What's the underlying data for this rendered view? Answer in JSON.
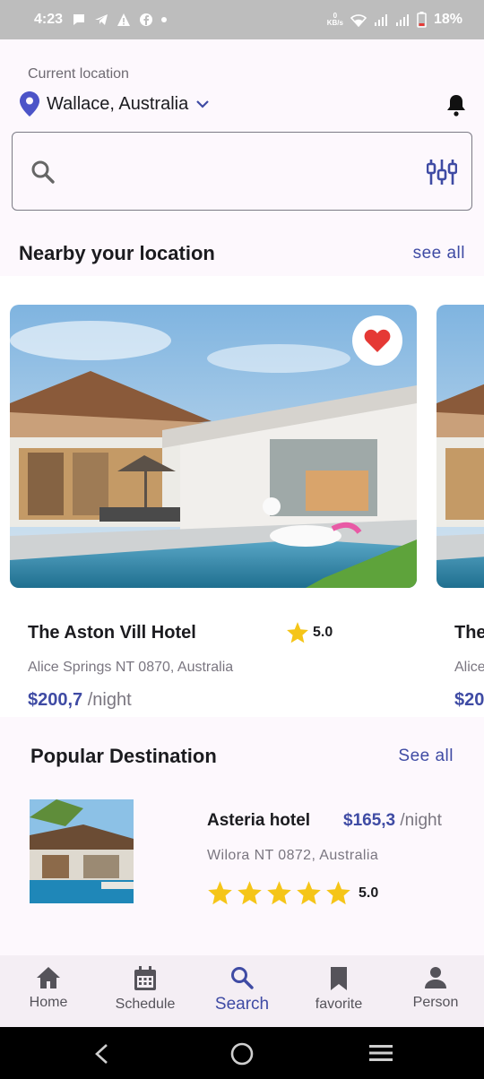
{
  "status_bar": {
    "time": "4:23",
    "net_speed_value": "0",
    "net_speed_unit": "KB/s",
    "battery": "18%"
  },
  "header": {
    "location_label": "Current location",
    "location": "Wallace, Australia"
  },
  "search": {
    "placeholder": ""
  },
  "nearby": {
    "title": "Nearby your location",
    "see_all": "see all",
    "cards": [
      {
        "name": "The Aston Vill Hotel",
        "rating": "5.0",
        "address": "Alice Springs NT 0870, Australia",
        "price": "$200,7",
        "unit": "/night",
        "favorite": true
      },
      {
        "name": "The",
        "address": "Alice",
        "price": "$20"
      }
    ]
  },
  "popular": {
    "title": "Popular Destination",
    "see_all": "See all",
    "items": [
      {
        "name": "Asteria hotel",
        "price": "$165,3",
        "unit": "/night",
        "address": "Wilora NT 0872, Australia",
        "rating": "5.0",
        "stars": 5
      }
    ]
  },
  "bottom_nav": [
    {
      "label": "Home",
      "icon": "home-icon",
      "active": false
    },
    {
      "label": "Schedule",
      "icon": "calendar-icon",
      "active": false
    },
    {
      "label": "Search",
      "icon": "search-icon",
      "active": true
    },
    {
      "label": "favorite",
      "icon": "bookmark-icon",
      "active": false
    },
    {
      "label": "Person",
      "icon": "person-icon",
      "active": false
    }
  ],
  "colors": {
    "accent": "#3f4ba4",
    "heart": "#e53935",
    "star": "#f5c518",
    "pin": "#4c54c8"
  }
}
